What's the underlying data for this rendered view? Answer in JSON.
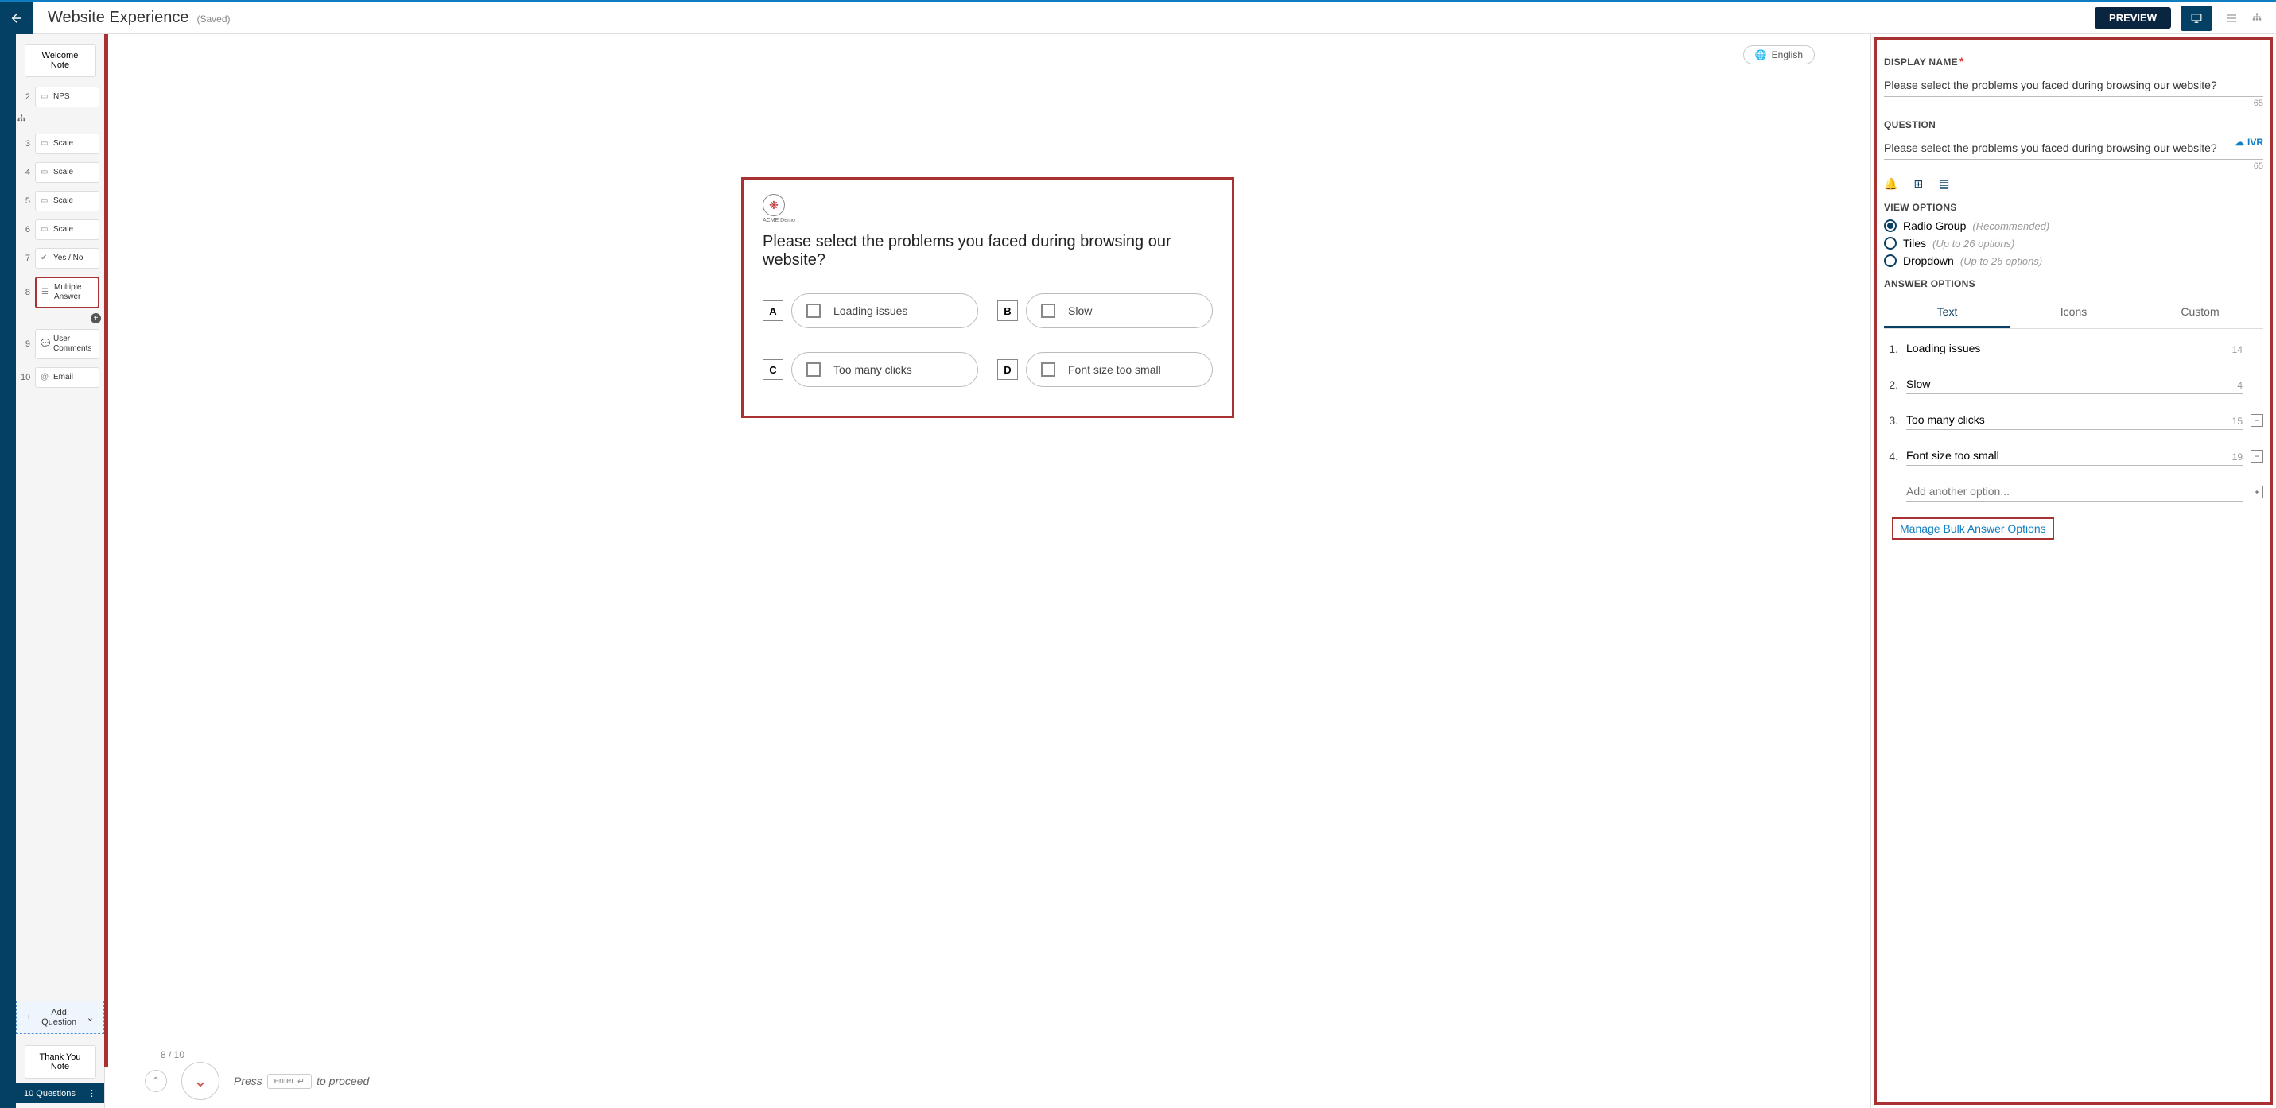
{
  "header": {
    "title": "Website Experience",
    "saved": "(Saved)",
    "preview": "PREVIEW"
  },
  "sidebar": {
    "welcome": "Welcome Note",
    "items": [
      {
        "num": "2",
        "label": "NPS",
        "icon": "▭"
      },
      {
        "num": "3",
        "label": "Scale",
        "icon": "▭"
      },
      {
        "num": "4",
        "label": "Scale",
        "icon": "▭"
      },
      {
        "num": "5",
        "label": "Scale",
        "icon": "▭"
      },
      {
        "num": "6",
        "label": "Scale",
        "icon": "▭"
      },
      {
        "num": "7",
        "label": "Yes / No",
        "icon": "✔"
      },
      {
        "num": "8",
        "label": "Multiple Answer",
        "icon": "☰",
        "active": true
      },
      {
        "num": "9",
        "label": "User Comments",
        "icon": "💬"
      },
      {
        "num": "10",
        "label": "Email",
        "icon": "@"
      }
    ],
    "add_question": "Add Question",
    "thank_you": "Thank You Note",
    "footer_count": "10 Questions"
  },
  "canvas": {
    "language": "English",
    "brand": "ACME Demo",
    "question": "Please select the problems you faced during browsing our website?",
    "options": [
      {
        "letter": "A",
        "label": "Loading issues"
      },
      {
        "letter": "B",
        "label": "Slow"
      },
      {
        "letter": "C",
        "label": "Too many clicks"
      },
      {
        "letter": "D",
        "label": "Font size too small"
      }
    ],
    "progress": "8 / 10",
    "press": "Press",
    "enter_key": "enter",
    "arrow": "↵",
    "proceed": "to proceed"
  },
  "panel": {
    "display_name_label": "DISPLAY NAME",
    "display_name": "Please select the problems you faced during browsing our website?",
    "display_name_count": "65",
    "question_label": "QUESTION",
    "question": "Please select the problems you faced during browsing our website?",
    "question_count": "65",
    "ivr": "IVR",
    "view_options_label": "VIEW OPTIONS",
    "view_options": [
      {
        "label": "Radio Group",
        "hint": "(Recommended)",
        "selected": true
      },
      {
        "label": "Tiles",
        "hint": "(Up to 26 options)"
      },
      {
        "label": "Dropdown",
        "hint": "(Up to 26 options)"
      }
    ],
    "answer_options_label": "ANSWER OPTIONS",
    "tabs": [
      {
        "label": "Text",
        "active": true
      },
      {
        "label": "Icons"
      },
      {
        "label": "Custom"
      }
    ],
    "answers": [
      {
        "num": "1.",
        "text": "Loading issues",
        "count": "14"
      },
      {
        "num": "2.",
        "text": "Slow",
        "count": "4"
      },
      {
        "num": "3.",
        "text": "Too many clicks",
        "count": "15",
        "deletable": true
      },
      {
        "num": "4.",
        "text": "Font size too small",
        "count": "19",
        "deletable": true
      }
    ],
    "add_another": "Add another option...",
    "bulk_link": "Manage Bulk Answer Options"
  }
}
